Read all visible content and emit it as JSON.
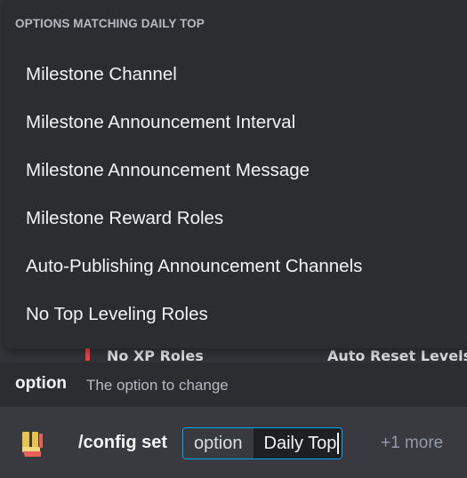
{
  "autocomplete": {
    "header": "OPTIONS MATCHING DAILY TOP",
    "options": [
      "Milestone Channel",
      "Milestone Announcement Interval",
      "Milestone Announcement Message",
      "Milestone Reward Roles",
      "Auto-Publishing Announcement Channels",
      "No Top Leveling Roles"
    ]
  },
  "background_peek": {
    "left_text": "No XP Roles",
    "right_text": "Auto Reset Levels"
  },
  "option_info": {
    "name": "option",
    "description": "The option to change"
  },
  "command_bar": {
    "command": "/config set",
    "param_label": "option",
    "param_value": "Daily Top",
    "more": "+1 more"
  },
  "colors": {
    "background": "#313338",
    "popup": "#2b2d31",
    "input_bar": "#383a40",
    "focus_border": "#00a8fc",
    "accent_red": "#f23f43"
  }
}
